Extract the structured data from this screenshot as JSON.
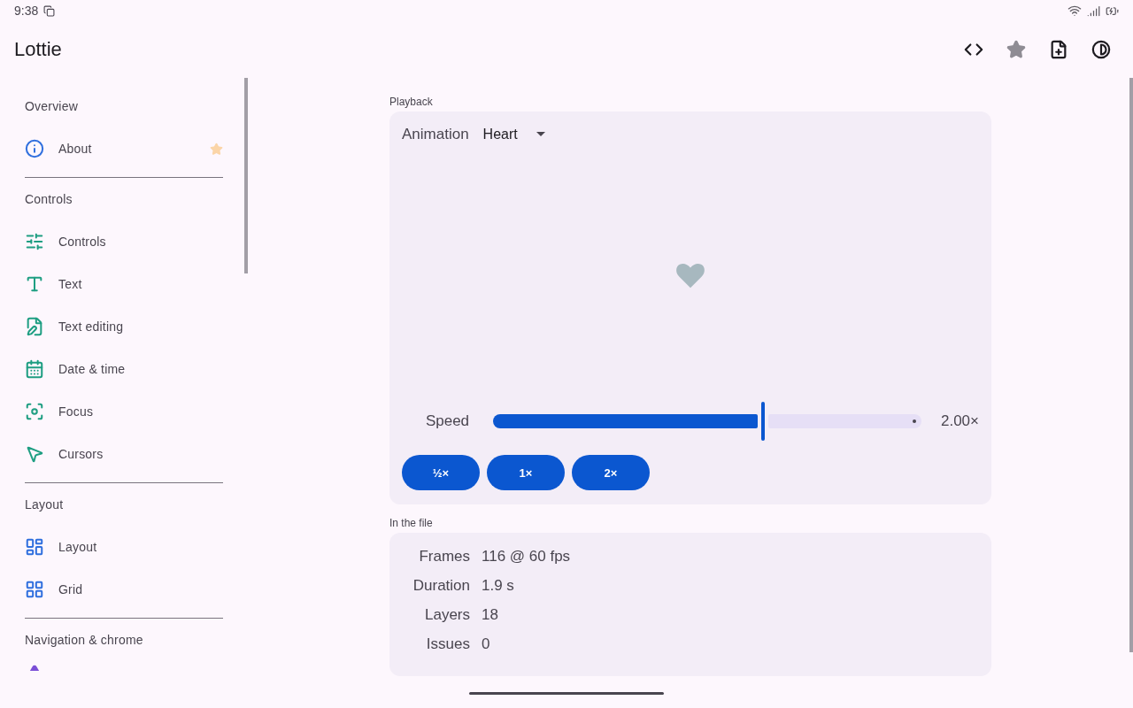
{
  "status_bar": {
    "time": "9:38"
  },
  "app_bar": {
    "title": "Lottie",
    "actions": [
      {
        "disabled": false
      },
      {
        "disabled": true
      },
      {
        "disabled": false
      },
      {
        "disabled": false
      }
    ]
  },
  "sidebar": {
    "groups": [
      {
        "title": "Overview",
        "items": [
          {
            "label": "About",
            "color": "#2f6fde",
            "starred": true
          }
        ]
      },
      {
        "title": "Controls",
        "items": [
          {
            "label": "Controls",
            "color": "#1e9e82",
            "starred": false
          },
          {
            "label": "Text",
            "color": "#1e9e82",
            "starred": false
          },
          {
            "label": "Text editing",
            "color": "#1e9e82",
            "starred": false
          },
          {
            "label": "Date & time",
            "color": "#1e9e82",
            "starred": false
          },
          {
            "label": "Focus",
            "color": "#1e9e82",
            "starred": false
          },
          {
            "label": "Cursors",
            "color": "#1e9e82",
            "starred": false
          }
        ]
      },
      {
        "title": "Layout",
        "items": [
          {
            "label": "Layout",
            "color": "#2f6fde",
            "starred": false
          },
          {
            "label": "Grid",
            "color": "#2f6fde",
            "starred": false
          }
        ]
      },
      {
        "title": "Navigation & chrome",
        "items": [
          {
            "color": "#7b4fd6"
          }
        ]
      }
    ]
  },
  "playback": {
    "heading": "Playback",
    "animation": {
      "label": "Animation",
      "value": "Heart"
    },
    "speed": {
      "label": "Speed",
      "level": 0.63,
      "reading": "2.00×"
    },
    "presets": [
      "½×",
      "1×",
      "2×"
    ]
  },
  "file_info": {
    "heading": "In the file",
    "rows": [
      {
        "label": "Frames",
        "value": "116 @ 60 fps"
      },
      {
        "label": "Duration",
        "value": "1.9 s"
      },
      {
        "label": "Layers",
        "value": "18"
      },
      {
        "label": "Issues",
        "value": "0"
      }
    ]
  }
}
